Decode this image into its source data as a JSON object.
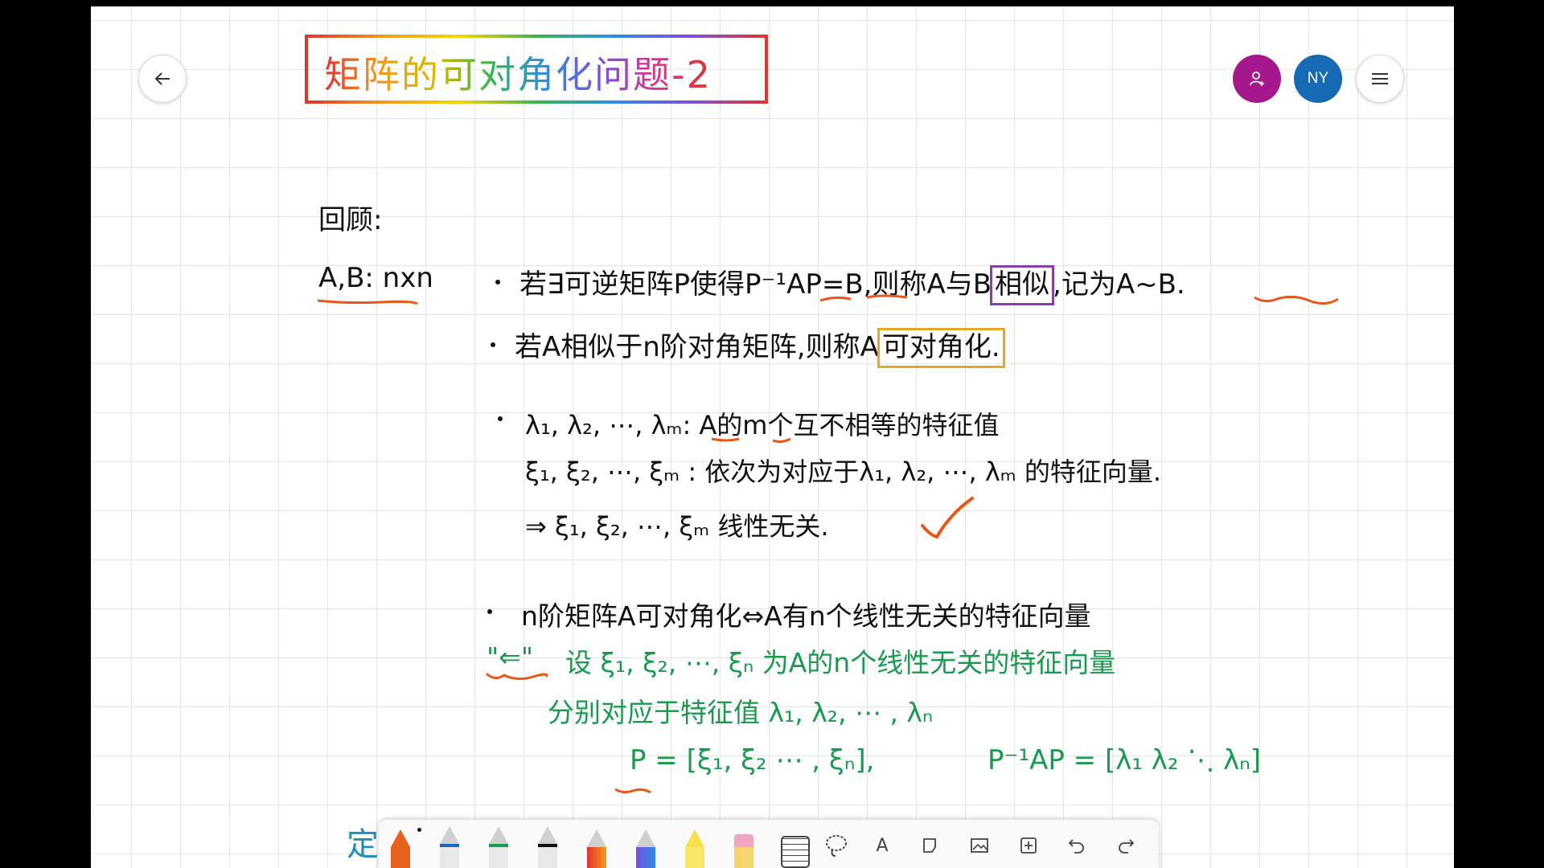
{
  "header": {
    "title": "矩阵的可对角化问题-2",
    "avatar_initials": "NY",
    "back_icon": "arrow-left-icon",
    "add_user_icon": "add-person-icon",
    "menu_icon": "hamburger-icon"
  },
  "notes": {
    "review_label": "回顾:",
    "ab_label": "A,B: nxn",
    "line1_a": "若∃可逆矩阵P使得P⁻¹AP=B,则称A与B",
    "line1_box": "相似",
    "line1_b": ",记为A~B.",
    "line2_a": "若A相似于n阶对角矩阵,则称A",
    "line2_box": "可对角化.",
    "line3": "λ₁, λ₂, ⋯, λₘ: A的m个互不相等的特征值",
    "line4": "ξ₁, ξ₂, ⋯, ξₘ : 依次为对应于λ₁, λ₂, ⋯, λₘ 的特征向量.",
    "line5": "⇒ ξ₁, ξ₂, ⋯, ξₘ 线性无关.",
    "line6": "n阶矩阵A可对角化⇔A有n个线性无关的特征向量",
    "line7_mark": "\"⇐\"",
    "line7": "设 ξ₁, ξ₂, ⋯, ξₙ 为A的n个线性无关的特征向量",
    "line8": "分别对应于特征值 λ₁, λ₂, ⋯ , λₙ",
    "line9_a": "P = [ξ₁, ξ₂ ⋯ , ξₙ],",
    "line9_b": "P⁻¹AP = [λ₁ λ₂ ⋱ λₙ]",
    "cut_off_char": "定"
  },
  "colors": {
    "ink": "#111111",
    "green_ink": "#1a9a4e",
    "underline": "#e8561a",
    "box_purple": "#8a3fa8",
    "box_gold": "#e5a823",
    "check": "#e8561a"
  },
  "toolbar": {
    "tools": [
      "orange-pen",
      "blue-pen",
      "green-pen",
      "black-pen",
      "red-pen",
      "purple-pen",
      "highlighter",
      "eraser",
      "ruler",
      "lasso-icon",
      "text-icon",
      "shape-icon",
      "image-icon",
      "add-icon",
      "undo-icon",
      "redo-icon"
    ],
    "text_tool_label": "A"
  }
}
